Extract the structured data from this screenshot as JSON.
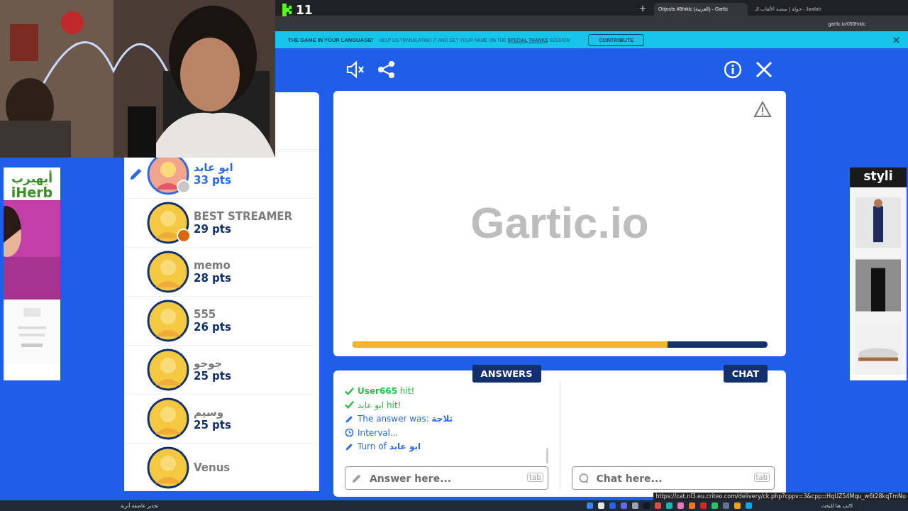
{
  "stream_overlay": {
    "viewers": "11"
  },
  "browser": {
    "tabs": [
      {
        "title": "Objects #5fnklc (العربية) - Gartic",
        "selected": true
      },
      {
        "title": "جولة | منصة الألعاب الـ - Jawlah",
        "selected": false
      }
    ],
    "url": "gartic.io/055fnklc"
  },
  "banner": {
    "headline": "THE GAME IN YOUR LANGUAGE!",
    "message": "HELP US TRANSLATING IT AND GET YOUR NAME ON THE **SPECIAL THANKS** SESSION",
    "button": "CONTRIBUTE"
  },
  "ads": {
    "left": {
      "logo_ar": "أيهيرب",
      "logo": "iHerb"
    },
    "right": {
      "logo": "styli"
    }
  },
  "players": [
    {
      "name": "ابو عابد",
      "points": "33 pts",
      "drawing": true,
      "color": "#c8c8c8"
    },
    {
      "name": "BEST STREAMER",
      "points": "29 pts",
      "drawing": false,
      "color": "#d9660f"
    },
    {
      "name": "memo",
      "points": "28 pts",
      "drawing": false
    },
    {
      "name": "555",
      "points": "26 pts",
      "drawing": false
    },
    {
      "name": "جوجو",
      "points": "25 pts",
      "drawing": false
    },
    {
      "name": "وسيم",
      "points": "25 pts",
      "drawing": false
    },
    {
      "name": "Venus",
      "drawing": false
    }
  ],
  "canvas": {
    "watermark": "Gartic.io",
    "timer": {
      "level": 0.76
    }
  },
  "answers": {
    "title": "ANSWERS",
    "log": [
      {
        "kind": "hit",
        "text": "**User665** hit!"
      },
      {
        "kind": "hit",
        "text": "ابو عابد hit!"
      },
      {
        "kind": "turn",
        "text": "The answer was: **ثلاجة**"
      },
      {
        "kind": "interval",
        "text": "Interval..."
      },
      {
        "kind": "turn",
        "text": "Turn of **ابو عابد**"
      }
    ],
    "placeholder": "Answer here...",
    "key_hint": "tab"
  },
  "chat": {
    "title": "CHAT",
    "placeholder": "Chat here...",
    "key_hint": "tab"
  },
  "status_url": "https://cat.nl3.eu.criteo.com/delivery/ck.php?cppv=3&cpp=HqUZ54Mqu_w6t28kqTmNu",
  "taskbar": {
    "weather": "تحذير عاصفة أتربة",
    "search": "اكتب هنا للبحث"
  }
}
